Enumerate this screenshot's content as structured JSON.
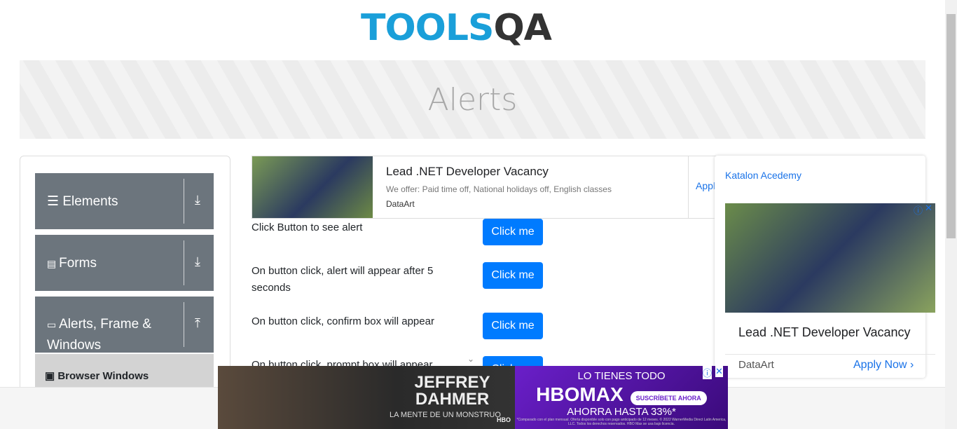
{
  "logo": {
    "part1": "TOOLS",
    "part2": "QA"
  },
  "page_title": "Alerts",
  "sidebar": {
    "groups": [
      {
        "label": "Elements",
        "icon": "hamburger-icon",
        "state": "download-icon"
      },
      {
        "label": "Forms",
        "icon": "document-icon",
        "state": "download-icon"
      },
      {
        "label": "Alerts, Frame & Windows",
        "icon": "window-icon",
        "state": "upload-icon"
      }
    ],
    "sub_item": "Browser Windows"
  },
  "ad_top": {
    "title": "Lead .NET Developer Vacancy",
    "desc": "We offer: Paid time off, National holidays off, English classes",
    "advertiser": "DataArt",
    "cta": "Appl"
  },
  "rows": [
    {
      "text": "Click Button to see alert",
      "button": "Click me"
    },
    {
      "text": "On button click, alert will appear after 5 seconds",
      "button": "Click me"
    },
    {
      "text": "On button click, confirm box will appear",
      "button": "Click me"
    },
    {
      "text": "On button click, prompt box will appear",
      "button": "Click me"
    }
  ],
  "ad_right": {
    "broken_image": "Katalon Acedemy",
    "title": "Lead .NET Developer Vacancy",
    "advertiser": "DataArt",
    "cta": "Apply Now"
  },
  "ad_bottom": {
    "left_title": "JEFFREY DAHMER",
    "left_sub": "LA MENTE DE UN MONSTRUO",
    "left_brand": "HBO",
    "r1": "LO TIENES TODO",
    "r2": "HBOMAX",
    "r_btn": "SUSCRÍBETE AHORA",
    "r3": "AHORRA HASTA 33%*",
    "r_fine": "*Comparado con el plan mensual. Oferta disponible solo con pago anticipado de 12 meses. © 2022 WarnerMedia Direct Latin America, LLC. Todos los derechos reservados. HBO Max se usa bajo licencia."
  }
}
